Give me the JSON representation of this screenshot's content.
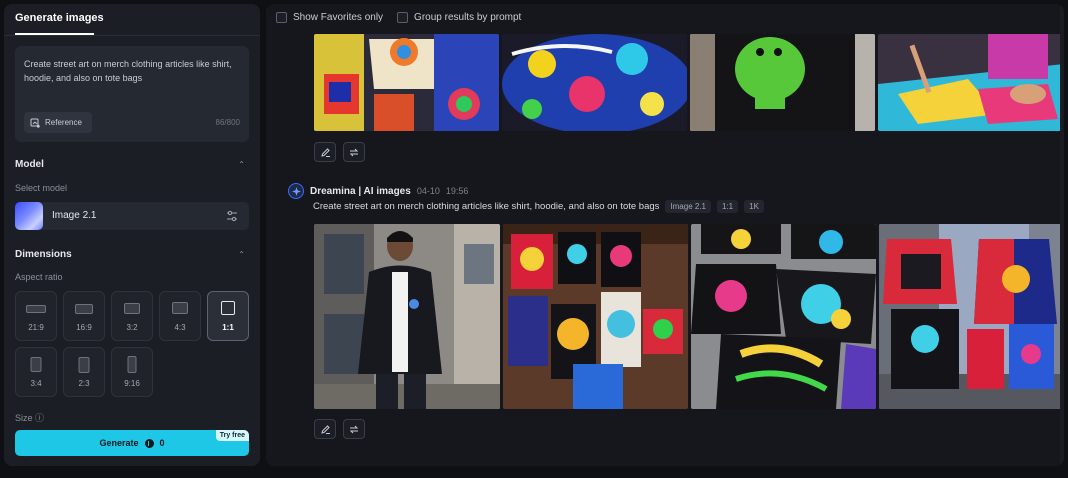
{
  "left_panel": {
    "tab_label": "Generate images",
    "prompt": {
      "text": "Create street art on merch clothing articles like shirt, hoodie, and also on tote bags",
      "reference_label": "Reference",
      "char_count": "86/800"
    },
    "model": {
      "section_title": "Model",
      "select_label": "Select model",
      "selected": "Image 2.1"
    },
    "dimensions": {
      "section_title": "Dimensions",
      "aspect_label": "Aspect ratio",
      "ratios": [
        "21:9",
        "16:9",
        "3:2",
        "4:3",
        "1:1",
        "3:4",
        "2:3",
        "9:16"
      ],
      "selected_ratio": "1:1"
    },
    "size_label": "Size",
    "generate": {
      "label": "Generate",
      "credits": "0",
      "badge": "Try free"
    }
  },
  "results": {
    "filters": {
      "favorites": "Show Favorites only",
      "group": "Group results by prompt"
    },
    "entry": {
      "brand": "Dreamina | AI images",
      "date": "04-10",
      "time": "19:56",
      "prompt": "Create street art on merch clothing articles like shirt, hoodie, and also on tote bags",
      "tags": [
        "Image 2.1",
        "1:1",
        "1K"
      ]
    }
  },
  "colors": {
    "accent": "#1fc7e6",
    "panel": "#1b1e25",
    "background": "#0e1014"
  },
  "icons": [
    "reference-icon",
    "chevron-up-icon",
    "settings-sliders-icon",
    "edit-icon",
    "regenerate-icon",
    "coin-icon",
    "dreamina-logo-icon"
  ]
}
